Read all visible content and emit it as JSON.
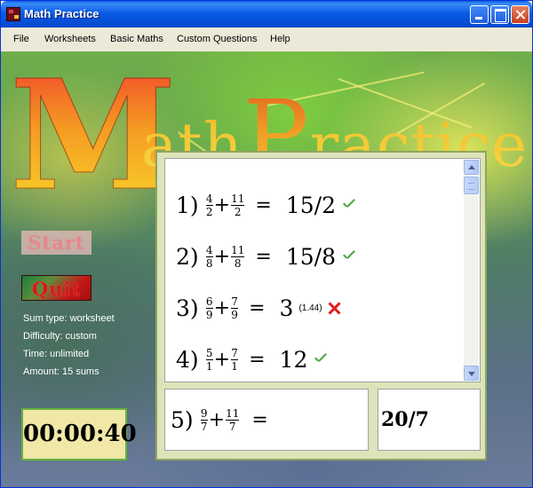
{
  "window": {
    "title": "Math Practice",
    "icon": "app-icon"
  },
  "menu": [
    "File",
    "Worksheets",
    "Basic Maths",
    "Custom Questions",
    "Help"
  ],
  "banner": {
    "first_letter": "M",
    "part1": "ath",
    "second_cap": "P",
    "part2": "ractice"
  },
  "buttons": {
    "start": "Start",
    "quit": "Quit"
  },
  "info": {
    "sum_type": "Sum type: worksheet",
    "difficulty": "Difficulty: custom",
    "time": "Time: unlimited",
    "amount": "Amount: 15 sums"
  },
  "timer": "00:00:40",
  "questions": [
    {
      "num": "1)",
      "a_num": "4",
      "a_den": "2",
      "op": "+",
      "b_num": "11",
      "b_den": "2",
      "eq": "=",
      "answer": "15/2",
      "note": "",
      "result": "correct"
    },
    {
      "num": "2)",
      "a_num": "4",
      "a_den": "8",
      "op": "+",
      "b_num": "11",
      "b_den": "8",
      "eq": "=",
      "answer": "15/8",
      "note": "",
      "result": "correct"
    },
    {
      "num": "3)",
      "a_num": "6",
      "a_den": "9",
      "op": "+",
      "b_num": "7",
      "b_den": "9",
      "eq": "=",
      "answer": "3",
      "note": "(1.44)",
      "result": "wrong"
    },
    {
      "num": "4)",
      "a_num": "5",
      "a_den": "1",
      "op": "+",
      "b_num": "7",
      "b_den": "1",
      "eq": "=",
      "answer": "12",
      "note": "",
      "result": "correct"
    }
  ],
  "current_question": {
    "num": "5)",
    "a_num": "9",
    "a_den": "7",
    "op": "+",
    "b_num": "11",
    "b_den": "7",
    "eq": "="
  },
  "answer_input": "20/7",
  "colors": {
    "check": "#4aa640",
    "cross": "#e02020",
    "panel": "#dde4b9",
    "timer_bg": "#f1e7a6"
  }
}
